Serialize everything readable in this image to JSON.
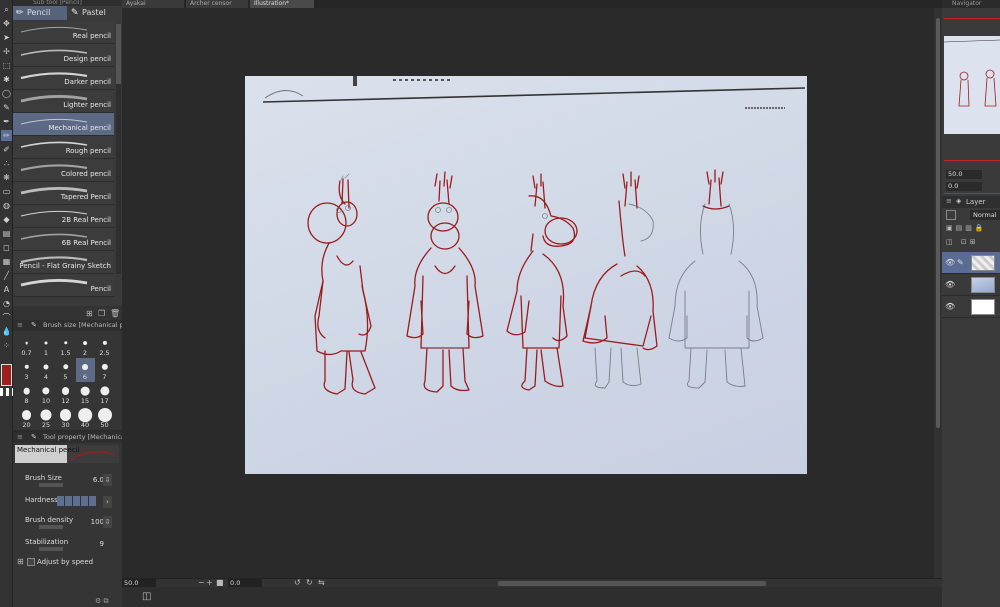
{
  "document_tabs": [
    "Ayakai",
    "Archer censor",
    "Illustration*"
  ],
  "subtool_panel": {
    "header": "Sub tool [Pencil]",
    "tabs": [
      {
        "label": "Pencil",
        "icon": "pencil-icon"
      },
      {
        "label": "Pastel",
        "icon": "pastel-icon"
      }
    ],
    "brushes": [
      "Real pencil",
      "Design pencil",
      "Darker pencil",
      "Lighter pencil",
      "Mechanical pencil",
      "Rough pencil",
      "Colored pencil",
      "Tapered Pencil",
      "2B Real Pencil",
      "6B Real Pencil",
      "Pencil - Flat Grainy Sketch",
      "Pencil"
    ],
    "selected_index": 4
  },
  "brush_size_panel": {
    "header": "Brush size [Mechanical pencil]",
    "sizes": [
      "0.7",
      "1",
      "1.5",
      "2",
      "2.5",
      "3",
      "4",
      "5",
      "6",
      "7",
      "8",
      "10",
      "12",
      "15",
      "17",
      "20",
      "25",
      "30",
      "40",
      "50"
    ],
    "selected": "6"
  },
  "tool_property_panel": {
    "header": "Tool property [Mechanical pencil]",
    "preset_name": "Mechanical pencil",
    "brush_size_label": "Brush Size",
    "brush_size_value": "6.0",
    "hardness_label": "Hardness",
    "brush_density_label": "Brush density",
    "brush_density_value": "100",
    "stabilization_label": "Stabilization",
    "stabilization_value": "9",
    "adjust_by_speed_label": "Adjust by speed"
  },
  "status_bar": {
    "zoom": "50.0",
    "angle": "0.0"
  },
  "right_panel": {
    "navigator_title": "Navigator",
    "zoom_value": "50.0",
    "angle_value": "0.0",
    "layer_tab": "Layer",
    "blend_mode": "Normal"
  },
  "colors": {
    "main": "#9c1e1e",
    "accent": "#5c6a86",
    "sketch_red": "#9b1c1c"
  }
}
